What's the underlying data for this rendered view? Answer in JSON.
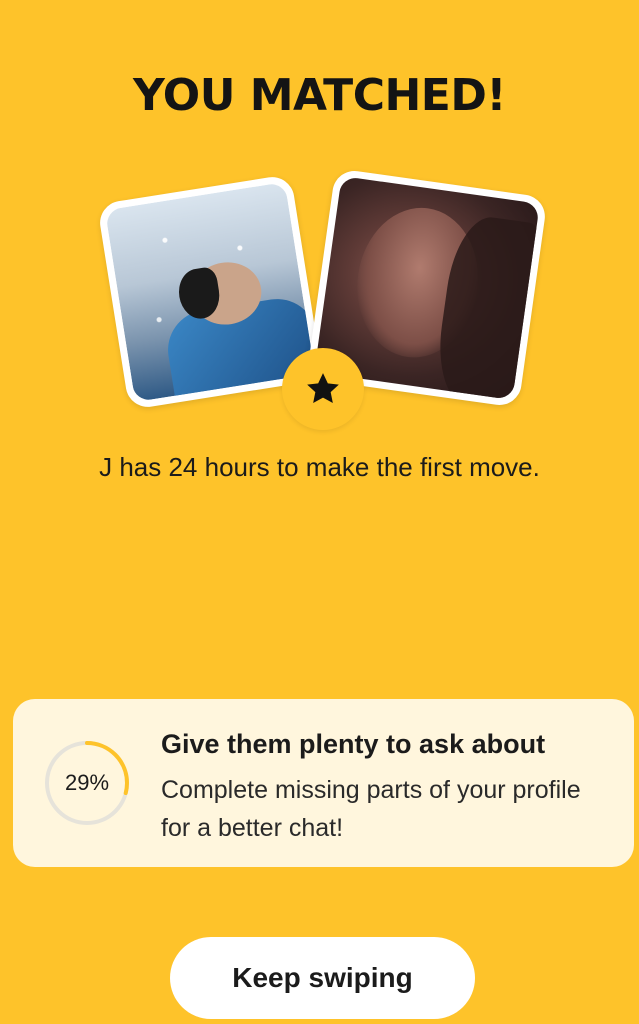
{
  "match": {
    "title": "YOU MATCHED!",
    "subtitle": "J has 24 hours to make the first move.",
    "badge_icon": "star-icon"
  },
  "prompt": {
    "progress_percent": 29,
    "progress_label": "29%",
    "title": "Give them plenty to ask about",
    "body": "Complete missing parts of your profile for a better chat!"
  },
  "actions": {
    "keep_swiping_label": "Keep swiping"
  },
  "colors": {
    "background": "#FEC32A",
    "card": "#FFF6DD",
    "progress": "#FEC32A",
    "progress_track": "#E6E3DA"
  }
}
